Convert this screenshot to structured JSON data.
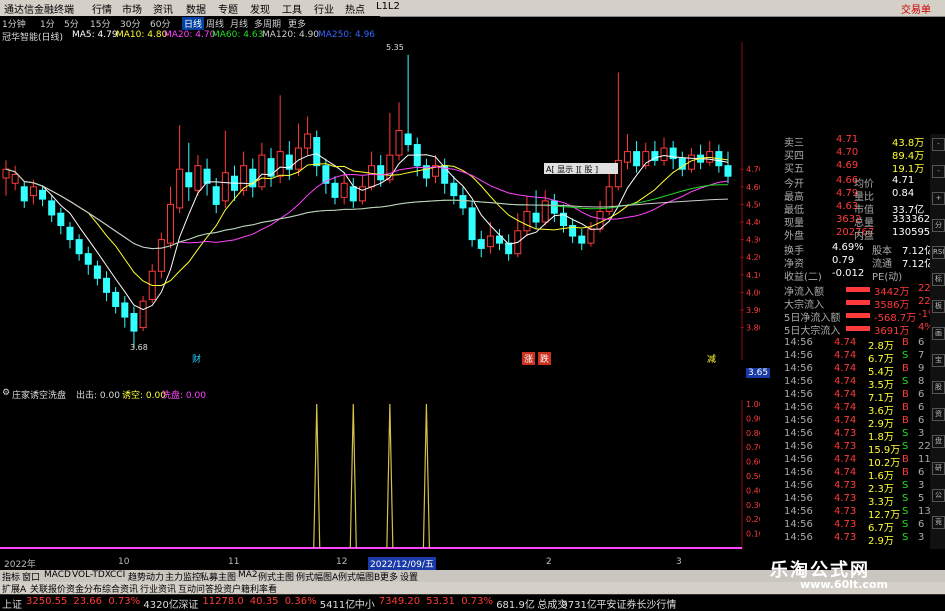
{
  "app": {
    "title": "通达信金融终端",
    "right_label": "交易单"
  },
  "menu": [
    "行情",
    "市场",
    "资讯",
    "数据",
    "专题",
    "发现",
    "工具",
    "行业",
    "热点",
    "L1L2"
  ],
  "periods": [
    "1分钟",
    "1分",
    "5分",
    "15分",
    "30分",
    "60分",
    "日线",
    "周线",
    "月线",
    "多周期",
    "更多"
  ],
  "active_period": "日线",
  "ma_legend": [
    {
      "label": "冠华智能(日线)",
      "color": "#dddddd"
    },
    {
      "label": "MA5: 4.79",
      "color": "#ffffff"
    },
    {
      "label": "MA10: 4.80",
      "color": "#ffff33"
    },
    {
      "label": "MA20: 4.70",
      "color": "#ff44ff"
    },
    {
      "label": "MA60: 4.63",
      "color": "#22dd22"
    },
    {
      "label": "MA120: 4.90",
      "color": "#cccccc"
    },
    {
      "label": "MA250: 4.96",
      "color": "#3366ff"
    }
  ],
  "price_axis": [
    "4.70",
    "4.60",
    "4.50",
    "4.40",
    "4.30",
    "4.20",
    "4.10",
    "4.00",
    "3.90",
    "3.80"
  ],
  "chart": {
    "high_label": "5.35",
    "low_label": "3.68",
    "price_tag": "3.65",
    "event_labels": [
      "财",
      "涨",
      "跌",
      "减"
    ],
    "tooltip": "A[ 显示 ][ 股 ]"
  },
  "candles": [
    [
      4.65,
      4.7,
      4.55,
      4.75
    ],
    [
      4.62,
      4.67,
      4.58,
      4.72
    ],
    [
      4.6,
      4.52,
      4.48,
      4.63
    ],
    [
      4.55,
      4.6,
      4.5,
      4.64
    ],
    [
      4.58,
      4.53,
      4.49,
      4.61
    ],
    [
      4.52,
      4.44,
      4.4,
      4.55
    ],
    [
      4.45,
      4.38,
      4.33,
      4.48
    ],
    [
      4.37,
      4.3,
      4.25,
      4.4
    ],
    [
      4.3,
      4.22,
      4.18,
      4.33
    ],
    [
      4.22,
      4.16,
      4.1,
      4.26
    ],
    [
      4.15,
      4.08,
      4.04,
      4.18
    ],
    [
      4.08,
      4.0,
      3.95,
      4.12
    ],
    [
      4.0,
      3.92,
      3.88,
      4.03
    ],
    [
      3.94,
      3.86,
      3.8,
      3.98
    ],
    [
      3.88,
      3.78,
      3.68,
      3.92
    ],
    [
      3.8,
      3.95,
      3.78,
      3.98
    ],
    [
      3.96,
      4.12,
      3.94,
      4.16
    ],
    [
      4.12,
      4.3,
      4.08,
      4.34
    ],
    [
      4.28,
      4.5,
      4.25,
      4.6
    ],
    [
      4.48,
      4.7,
      4.45,
      4.95
    ],
    [
      4.68,
      4.6,
      4.52,
      4.85
    ],
    [
      4.58,
      4.72,
      4.55,
      4.78
    ],
    [
      4.7,
      4.62,
      4.55,
      4.76
    ],
    [
      4.6,
      4.5,
      4.45,
      4.65
    ],
    [
      4.52,
      4.68,
      4.48,
      4.92
    ],
    [
      4.66,
      4.58,
      4.52,
      4.72
    ],
    [
      4.58,
      4.72,
      4.55,
      4.8
    ],
    [
      4.7,
      4.6,
      4.54,
      4.76
    ],
    [
      4.6,
      4.78,
      4.58,
      4.85
    ],
    [
      4.76,
      4.66,
      4.6,
      4.82
    ],
    [
      4.66,
      4.8,
      4.62,
      5.12
    ],
    [
      4.78,
      4.7,
      4.64,
      4.86
    ],
    [
      4.7,
      4.82,
      4.66,
      4.96
    ],
    [
      4.82,
      4.9,
      4.78,
      5.0
    ],
    [
      4.88,
      4.72,
      4.66,
      4.92
    ],
    [
      4.72,
      4.62,
      4.56,
      4.76
    ],
    [
      4.62,
      4.54,
      4.5,
      4.66
    ],
    [
      4.54,
      4.62,
      4.5,
      4.68
    ],
    [
      4.6,
      4.52,
      4.48,
      4.65
    ],
    [
      4.52,
      4.6,
      4.5,
      4.66
    ],
    [
      4.6,
      4.72,
      4.58,
      4.8
    ],
    [
      4.72,
      4.64,
      4.6,
      4.78
    ],
    [
      4.64,
      4.78,
      4.62,
      5.02
    ],
    [
      4.78,
      4.92,
      4.75,
      5.08
    ],
    [
      4.9,
      4.84,
      4.8,
      5.35
    ],
    [
      4.84,
      4.72,
      4.66,
      4.88
    ],
    [
      4.72,
      4.65,
      4.6,
      4.76
    ],
    [
      4.66,
      4.72,
      4.62,
      4.78
    ],
    [
      4.72,
      4.62,
      4.56,
      4.76
    ],
    [
      4.62,
      4.55,
      4.5,
      4.66
    ],
    [
      4.55,
      4.48,
      4.44,
      4.6
    ],
    [
      4.48,
      4.3,
      4.26,
      4.52
    ],
    [
      4.3,
      4.25,
      4.2,
      4.35
    ],
    [
      4.26,
      4.32,
      4.22,
      4.4
    ],
    [
      4.32,
      4.28,
      4.24,
      4.36
    ],
    [
      4.28,
      4.22,
      4.18,
      4.33
    ],
    [
      4.22,
      4.35,
      4.2,
      4.45
    ],
    [
      4.35,
      4.46,
      4.32,
      4.55
    ],
    [
      4.45,
      4.4,
      4.36,
      4.58
    ],
    [
      4.4,
      4.52,
      4.38,
      4.58
    ],
    [
      4.52,
      4.45,
      4.4,
      4.56
    ],
    [
      4.45,
      4.38,
      4.34,
      4.5
    ],
    [
      4.38,
      4.32,
      4.28,
      4.42
    ],
    [
      4.32,
      4.28,
      4.24,
      4.36
    ],
    [
      4.28,
      4.36,
      4.26,
      4.4
    ],
    [
      4.36,
      4.46,
      4.34,
      4.52
    ],
    [
      4.46,
      4.6,
      4.44,
      4.7
    ],
    [
      4.6,
      4.75,
      4.58,
      5.25
    ],
    [
      4.74,
      4.8,
      4.7,
      4.9
    ],
    [
      4.8,
      4.72,
      4.68,
      4.86
    ],
    [
      4.72,
      4.8,
      4.7,
      4.85
    ],
    [
      4.8,
      4.75,
      4.72,
      4.86
    ],
    [
      4.75,
      4.82,
      4.72,
      4.88
    ],
    [
      4.82,
      4.76,
      4.7,
      4.86
    ],
    [
      4.76,
      4.7,
      4.66,
      4.8
    ],
    [
      4.7,
      4.78,
      4.68,
      4.82
    ],
    [
      4.78,
      4.74,
      4.7,
      4.84
    ],
    [
      4.74,
      4.8,
      4.72,
      4.86
    ],
    [
      4.8,
      4.72,
      4.68,
      4.84
    ],
    [
      4.72,
      4.66,
      4.62,
      4.8
    ]
  ],
  "indicator": {
    "name": "庄家诱空洗盘",
    "items": [
      {
        "label": "出击: 0.00",
        "color": "#dddddd"
      },
      {
        "label": "诱空: 0.00",
        "color": "#ffff33"
      },
      {
        "label": "洗盘: 0.00",
        "color": "#ff44ff"
      }
    ],
    "axis": [
      "1.00",
      "0.90",
      "0.80",
      "0.70",
      "0.60",
      "0.50",
      "0.40",
      "0.30",
      "0.20",
      "0.10"
    ],
    "spikes": [
      34,
      38,
      42,
      46
    ]
  },
  "dates": [
    {
      "label": "2022年",
      "active": false
    },
    {
      "label": "10",
      "active": false
    },
    {
      "label": "11",
      "active": false
    },
    {
      "label": "12",
      "active": false
    },
    {
      "label": "2022/12/09/五",
      "active": true
    },
    {
      "label": "2",
      "active": false
    },
    {
      "label": "3",
      "active": false
    }
  ],
  "tabs": [
    "指标",
    "窗口",
    "MACD",
    "VOL-TDX",
    "CCI",
    "趋势动力",
    "主力监控",
    "私募主图",
    "MA2",
    "例式主图",
    "例式幅图A",
    "例式幅图B",
    "更多",
    "设置"
  ],
  "bottom_tabs": [
    "扩展A",
    "关联报价",
    "资金分布",
    "综合资讯",
    "行业资讯",
    "互动问答",
    "投资户籍利率看"
  ],
  "quote": {
    "top_rows": [
      {
        "label": "卖三",
        "price": "4.71",
        "vol": "43.8万"
      },
      {
        "label": "买四",
        "price": "4.70",
        "vol": "89.4万"
      },
      {
        "label": "买五",
        "price": "4.69",
        "vol": "19.1万"
      }
    ],
    "stats": [
      {
        "l1": "今开",
        "v1": "4.66",
        "l2": "均价",
        "v2": "4.71"
      },
      {
        "l1": "最高",
        "v1": "4.79",
        "l2": "量比",
        "v2": "0.84"
      },
      {
        "l1": "最低",
        "v1": "4.63",
        "l2": "市值",
        "v2": "33.7亿"
      },
      {
        "l1": "现量",
        "v1": "3632",
        "l2": "总量",
        "v2": "333362"
      },
      {
        "l1": "外盘",
        "v1": "202767",
        "l2": "内盘",
        "v2": "130595"
      }
    ],
    "stats2": [
      {
        "l1": "换手",
        "v1": "4.69%",
        "l2": "股本",
        "v2": "7.12亿"
      },
      {
        "l1": "净资",
        "v1": "0.79",
        "l2": "流通",
        "v2": "7.12亿"
      },
      {
        "l1": "收益(二)",
        "v1": "-0.012",
        "l2": "PE(动)",
        "v2": ""
      }
    ],
    "flows": [
      {
        "label": "净流入额",
        "value": "3442万",
        "pct": "22%"
      },
      {
        "label": "大宗流入",
        "value": "3586万",
        "pct": "22%"
      },
      {
        "label": "5日净流入额",
        "value": "-568.7万",
        "pct": "-1%"
      },
      {
        "label": "5日大宗流入",
        "value": "3691万",
        "pct": "4%"
      }
    ],
    "ticks": [
      [
        "14:56",
        "4.74",
        "2.8万",
        "B",
        "6"
      ],
      [
        "14:56",
        "4.74",
        "6.7万",
        "S",
        "7"
      ],
      [
        "14:56",
        "4.74",
        "5.4万",
        "B",
        "9"
      ],
      [
        "14:56",
        "4.74",
        "3.5万",
        "S",
        "8"
      ],
      [
        "14:56",
        "4.74",
        "7.1万",
        "B",
        "6"
      ],
      [
        "14:56",
        "4.74",
        "3.6万",
        "B",
        "6"
      ],
      [
        "14:56",
        "4.74",
        "2.9万",
        "B",
        "6"
      ],
      [
        "14:56",
        "4.73",
        "1.8万",
        "S",
        "3"
      ],
      [
        "14:56",
        "4.73",
        "15.9万",
        "S",
        "22"
      ],
      [
        "14:56",
        "4.74",
        "10.2万",
        "B",
        "11"
      ],
      [
        "14:56",
        "4.74",
        "1.6万",
        "B",
        "6"
      ],
      [
        "14:56",
        "4.73",
        "2.3万",
        "S",
        "3"
      ],
      [
        "14:56",
        "4.73",
        "3.3万",
        "S",
        "5"
      ],
      [
        "14:56",
        "4.73",
        "12.7万",
        "S",
        "13"
      ],
      [
        "14:56",
        "4.73",
        "6.7万",
        "S",
        "6"
      ],
      [
        "14:56",
        "4.73",
        "2.9万",
        "S",
        "3"
      ]
    ]
  },
  "status": {
    "items": [
      {
        "label": "上证",
        "color": "#dddddd"
      },
      {
        "label": "3250.55",
        "color": "#ff3a3a"
      },
      {
        "label": "23.66",
        "color": "#ff3a3a"
      },
      {
        "label": "0.73%",
        "color": "#ff3a3a"
      },
      {
        "label": "4320亿",
        "color": "#dddddd"
      },
      {
        "label": "深证",
        "color": "#dddddd"
      },
      {
        "label": "11278.0",
        "color": "#ff3a3a"
      },
      {
        "label": "40.35",
        "color": "#ff3a3a"
      },
      {
        "label": "0.36%",
        "color": "#ff3a3a"
      },
      {
        "label": "5411亿",
        "color": "#dddddd"
      },
      {
        "label": "中小",
        "color": "#dddddd"
      },
      {
        "label": "7349.20",
        "color": "#ff3a3a"
      },
      {
        "label": "53.31",
        "color": "#ff3a3a"
      },
      {
        "label": "0.73%",
        "color": "#ff3a3a"
      },
      {
        "label": "681.9亿",
        "color": "#dddddd"
      },
      {
        "label": "总成交",
        "color": "#dddddd"
      },
      {
        "label": "9731亿",
        "color": "#dddddd"
      },
      {
        "label": "平安证券长沙行情",
        "color": "#dddddd"
      }
    ]
  },
  "watermark": {
    "title": "乐淘公式网",
    "url": "www.60lt.com"
  },
  "right_icons": [
    "-",
    "-",
    "+",
    "分",
    "RSI",
    "标",
    "板",
    "画",
    "宝",
    "股",
    "资",
    "盘",
    "研",
    "公",
    "竞"
  ],
  "colors": {
    "up": "#ff3a3a",
    "down": "#33ffff",
    "bg": "#000000"
  }
}
